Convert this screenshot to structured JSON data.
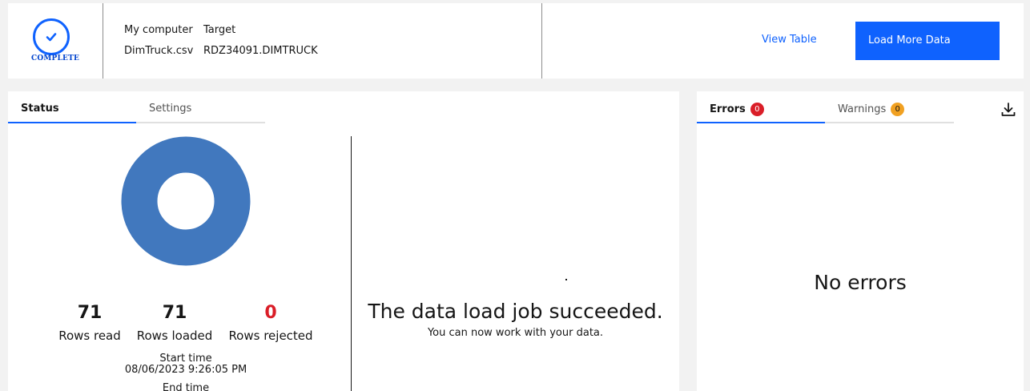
{
  "header": {
    "status_label": "COMPLETE",
    "source_label": "My computer",
    "target_label": "Target",
    "source_file": "DimTruck.csv",
    "target_table": "RDZ34091.DIMTRUCK",
    "view_table": "View Table",
    "load_more": "Load More Data"
  },
  "tabs": [
    {
      "label": "Status",
      "active": true
    },
    {
      "label": "Settings",
      "active": false
    }
  ],
  "status": {
    "donut_color": "#4178be",
    "stats": [
      {
        "value": "71",
        "label": "Rows read",
        "color": "#161616"
      },
      {
        "value": "71",
        "label": "Rows loaded",
        "color": "#161616"
      },
      {
        "value": "0",
        "label": "Rows rejected",
        "color": "#da1e28"
      }
    ],
    "start_time_label": "Start time",
    "start_time": "08/06/2023 9:26:05 PM",
    "end_time_label": "End time",
    "success_title": "The data load job succeeded.",
    "success_sub": "You can now work with your data."
  },
  "side": {
    "tabs": [
      {
        "label": "Errors",
        "count": "0"
      },
      {
        "label": "Warnings",
        "count": "0"
      }
    ],
    "download_icon": "download-icon",
    "empty_text": "No errors"
  },
  "colors": {
    "accent": "#0f62fe",
    "error": "#da1e28",
    "warning": "#f1a122"
  }
}
